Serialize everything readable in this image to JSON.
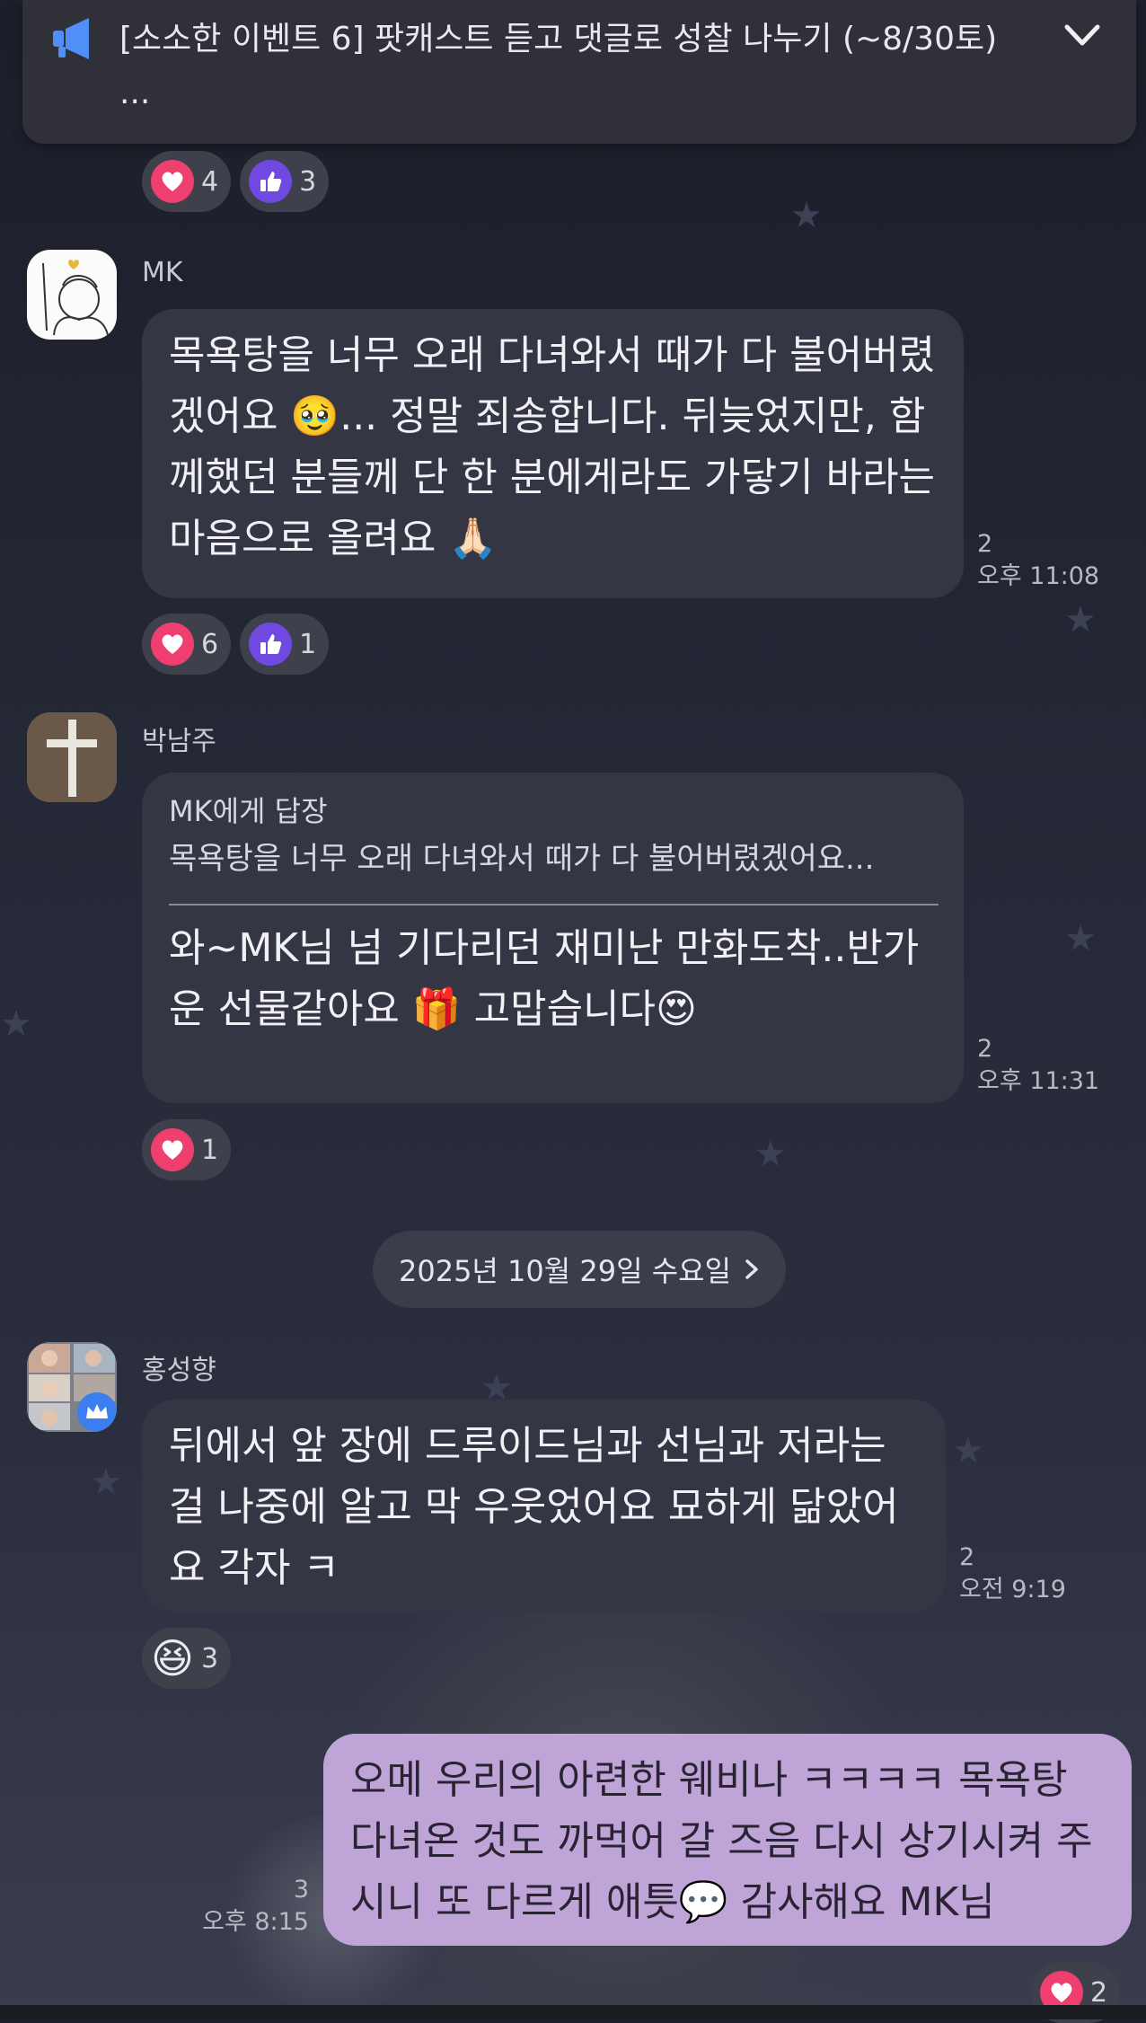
{
  "notice": {
    "text": "[소소한 이벤트 6] 팟캐스트 듣고 댓글로 성찰 나누기 (~8/30토)",
    "ellipsis": "..."
  },
  "messages": [
    {
      "sender": "MK",
      "text": "목욕탕을 너무 오래 다녀와서 때가 다 불어버렸겠어요 🥹... 정말 죄송합니다. 뒤늦었지만, 함께했던 분들께 단 한 분에게라도 가닿기 바라는 마음으로 올려요 🙏🏻",
      "unread": "2",
      "time": "오후 11:08"
    },
    {
      "sender": "박남주",
      "reply_to": "MK에게 답장",
      "reply_quote": "목욕탕을 너무 오래 다녀와서 때가 다 불어버렸겠어요...",
      "text": "와~MK님 넘 기다리던 재미난 만화도착..반가운 선물같아요 🎁  고맙습니다😍",
      "unread": "2",
      "time": "오후 11:31"
    },
    {
      "sender": "홍성향",
      "text": "뒤에서 앞 장에 드루이드님과 선님과 저라는 걸 나중에 알고 막 우웃었어요 묘하게 닮았어요 각자 ㅋ",
      "unread": "2",
      "time": "오전 9:19"
    },
    {
      "sender": "me",
      "text": "오메 우리의 아련한 웨비나 ㅋㅋㅋㅋ 목욕탕 다녀온 것도 까먹어 갈 즈음 다시 상기시켜 주시니 또 다르게 애틋💬 감사해요 MK님",
      "unread": "3",
      "time": "오후 8:15"
    }
  ],
  "reactions": {
    "top": {
      "heart": "4",
      "like": "3"
    },
    "mk": {
      "heart": "6",
      "like": "1"
    },
    "park": {
      "heart": "1"
    },
    "hong": {
      "grin": "3"
    },
    "me": {
      "heart": "2"
    }
  },
  "date_divider": "2025년 10월 29일 수요일",
  "colors": {
    "background": "#252836",
    "bubble": "#353644",
    "my_bubble": "#bfa4d8",
    "heart_reaction": "#ee3f6e",
    "like_reaction": "#6f49e0",
    "notice_icon": "#4f8ff7"
  }
}
